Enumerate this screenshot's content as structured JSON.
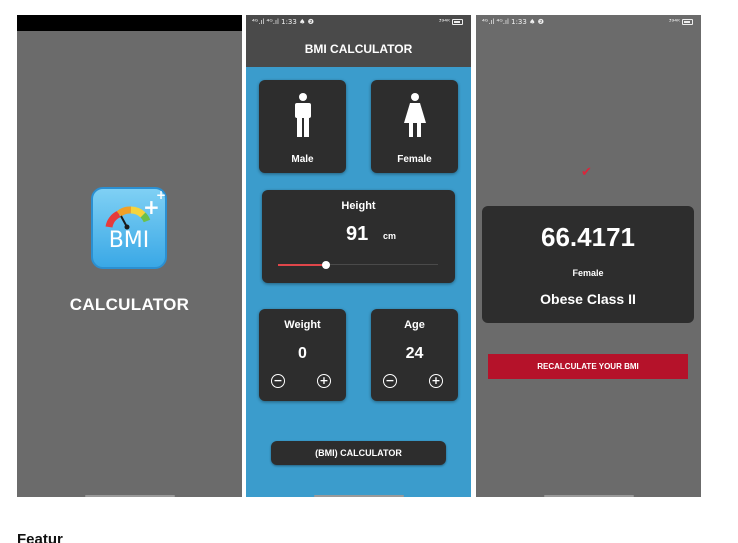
{
  "status_bar": {
    "left_text": "⁴ᴳ.ıl ⁴ᴳ.ıl 1:33 ♠ ❷",
    "right_text": "³⁹⁴ᴷ"
  },
  "splash": {
    "icon_label": "BMI",
    "title": "CALCULATOR"
  },
  "calculator": {
    "header_title": "BMI CALCULATOR",
    "male_label": "Male",
    "female_label": "Female",
    "height": {
      "label": "Height",
      "value": "91",
      "unit": "cm",
      "slider_fraction": 0.3
    },
    "weight": {
      "label": "Weight",
      "value": "0"
    },
    "age": {
      "label": "Age",
      "value": "24"
    },
    "calculate_button": "(BMI) CALCULATOR"
  },
  "result": {
    "bmi_value": "66.4171",
    "gender": "Female",
    "classification": "Obese Class II",
    "recalculate_button": "RECALCULATE YOUR BMI"
  },
  "caption": "Featur",
  "colors": {
    "accent_blue": "#3b9ccc",
    "card_dark": "#2d2d2d",
    "slider_red": "#e0464a",
    "recalc_red": "#b5122a",
    "splash_gray": "#6b6b6b"
  }
}
